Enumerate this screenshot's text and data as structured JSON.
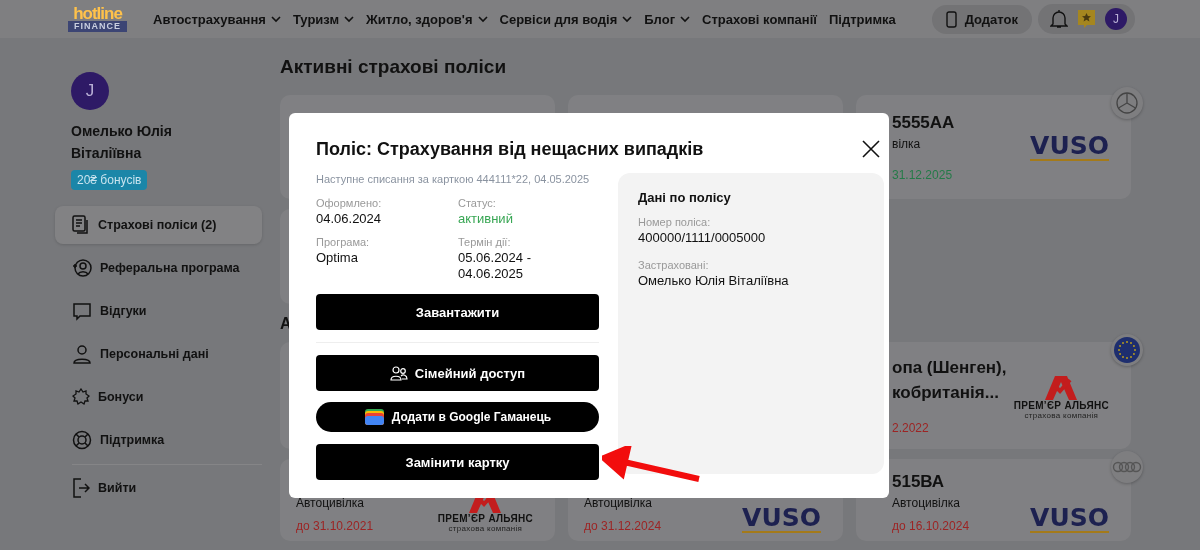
{
  "header": {
    "logo": {
      "top": "hotline",
      "bottom": "FINANCE"
    },
    "nav": [
      {
        "label": "Автострахування",
        "has_menu": true
      },
      {
        "label": "Туризм",
        "has_menu": true
      },
      {
        "label": "Житло, здоров'я",
        "has_menu": true
      },
      {
        "label": "Сервіси для водія",
        "has_menu": true
      },
      {
        "label": "Блог",
        "has_menu": true
      },
      {
        "label": "Страхові компанії",
        "has_menu": false
      },
      {
        "label": "Підтримка",
        "has_menu": false
      }
    ],
    "app_button": "Додаток",
    "avatar": "J"
  },
  "sidebar": {
    "avatar": "J",
    "name": "Омелько Юлія Віталіївна",
    "bonus": "20₴ бонусів",
    "items": [
      {
        "label": "Страхові поліси (2)",
        "kind": "policies",
        "selected": true
      },
      {
        "label": "Реферальна програма",
        "kind": "referral",
        "selected": false
      },
      {
        "label": "Відгуки",
        "kind": "reviews",
        "selected": false
      },
      {
        "label": "Персональні дані",
        "kind": "personal",
        "selected": false
      },
      {
        "label": "Бонуси",
        "kind": "bonuses",
        "selected": false
      },
      {
        "label": "Підтримка",
        "kind": "support",
        "selected": false
      },
      {
        "label": "Вийти",
        "kind": "logout",
        "selected": false
      }
    ]
  },
  "main": {
    "heading": "Активні страхові поліси",
    "active_cards": [
      {
        "title": "5555АА",
        "type": "вілка",
        "date": "31.12.2025",
        "expired": false,
        "logo": {
          "kind": "vuso",
          "text": "VUSO"
        },
        "badge": {
          "kind": "mercedes"
        }
      }
    ],
    "archive_heading": "А",
    "archive_cards": [
      {
        "title": "опа (Шенген),",
        "title_2": "кобританія...",
        "date": "2.2022",
        "expired": true,
        "logo": {
          "kind": "premier",
          "text": "ПРЕМ’ЄР АЛЬЯНС",
          "tagline": "страхова компанія"
        },
        "badge": {
          "kind": "eu"
        }
      },
      {
        "type": "Автоцивілка",
        "date": "до 31.10.2021",
        "expired": true,
        "logo": {
          "kind": "premier",
          "text": "ПРЕМ’ЄР АЛЬЯНС",
          "tagline": "страхова компанія"
        }
      },
      {
        "type": "Автоцивілка",
        "date": "до 31.12.2024",
        "expired": true,
        "logo": {
          "kind": "vuso",
          "text": "VUSO"
        }
      },
      {
        "title": "515ВА",
        "type": "Автоцивілка",
        "date": "до 16.10.2024",
        "expired": true,
        "logo": {
          "kind": "vuso",
          "text": "VUSO"
        },
        "badge": {
          "kind": "audi"
        }
      }
    ]
  },
  "modal": {
    "title": "Поліс: Страхування від нещасних випадків",
    "next_charge": "Наступне списання за карткою 444111*22, 04.05.2025",
    "fields": [
      {
        "label": "Оформлено:",
        "value": "04.06.2024",
        "kind": "plain"
      },
      {
        "label": "Статус:",
        "value": "активний",
        "kind": "status"
      },
      {
        "label": "Програма:",
        "value": "Optima",
        "kind": "plain"
      },
      {
        "label": "Термін дії:",
        "value": "05.06.2024 - 04.06.2025",
        "kind": "plain"
      }
    ],
    "buttons": [
      {
        "label": "Завантажити",
        "kind": "plain"
      },
      {
        "label": "Сімейний доступ",
        "kind": "family"
      },
      {
        "label": "Додати в Google Гаманець",
        "kind": "wallet"
      },
      {
        "label": "Замінити картку",
        "kind": "plain"
      }
    ],
    "details": {
      "title": "Дані по полісу",
      "fields": [
        {
          "label": "Номер поліса:",
          "value": "400000/1111/0005000"
        },
        {
          "label": "Застраховані:",
          "value": "Омелько Юлія Віталіївна"
        }
      ]
    }
  }
}
